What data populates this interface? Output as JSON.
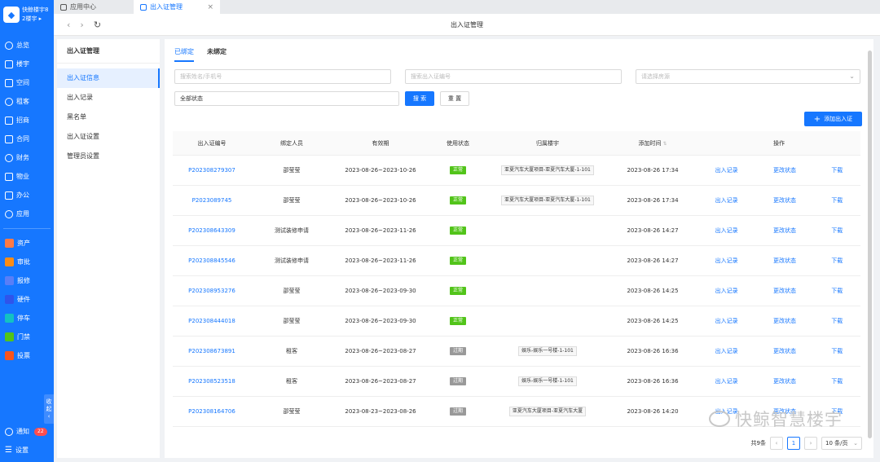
{
  "brand": {
    "name": "快鲸楼宇8",
    "sub": "2楼宇 ▸"
  },
  "sidebar": {
    "items": [
      {
        "label": "总览",
        "icon": "overview-icon"
      },
      {
        "label": "楼宇",
        "icon": "building-icon"
      },
      {
        "label": "空间",
        "icon": "space-icon"
      },
      {
        "label": "租客",
        "icon": "tenant-icon"
      },
      {
        "label": "招商",
        "icon": "investment-icon"
      },
      {
        "label": "合同",
        "icon": "contract-icon"
      },
      {
        "label": "财务",
        "icon": "finance-icon"
      },
      {
        "label": "物业",
        "icon": "property-icon"
      },
      {
        "label": "办公",
        "icon": "office-icon"
      },
      {
        "label": "应用",
        "icon": "apps-icon"
      }
    ],
    "apps": [
      {
        "label": "资产",
        "color": "#ff7a45"
      },
      {
        "label": "审批",
        "color": "#fa8c16"
      },
      {
        "label": "报修",
        "color": "#597ef7"
      },
      {
        "label": "硬件",
        "color": "#2f54eb"
      },
      {
        "label": "停车",
        "color": "#13c2c2"
      },
      {
        "label": "门禁",
        "color": "#52c41a"
      },
      {
        "label": "投票",
        "color": "#fa541c"
      }
    ],
    "collapse": {
      "line1": "收",
      "line2": "起"
    },
    "notify": {
      "label": "通知",
      "count": "22"
    },
    "settings": {
      "label": "设置"
    }
  },
  "tabs": [
    {
      "label": "应用中心"
    },
    {
      "label": "出入证管理"
    }
  ],
  "page_title": "出入证管理",
  "submenu": {
    "title": "出入证管理",
    "items": [
      "出入证信息",
      "出入记录",
      "黑名单",
      "出入证设置",
      "管理员设置"
    ]
  },
  "subtabs": [
    "已绑定",
    "未绑定"
  ],
  "filters": {
    "name_placeholder": "搜索姓名/手机号",
    "code_placeholder": "搜索出入证编号",
    "room_placeholder": "请选择房源",
    "status_value": "全部状态",
    "search_label": "搜 索",
    "reset_label": "重 置"
  },
  "add_button": "添加出入证",
  "table": {
    "headers": [
      "出入证编号",
      "绑定人员",
      "有效期",
      "使用状态",
      "归属楼宇",
      "添加时间",
      "操作"
    ],
    "rows": [
      {
        "code": "P202308279307",
        "person": "邵莹莹",
        "period": "2023-08-26~2023-10-26",
        "status": "正常",
        "building": "亚夏汽车大厦项目-亚夏汽车大厦-1-101",
        "time": "2023-08-26 17:34"
      },
      {
        "code": "P2023089745",
        "person": "邵莹莹",
        "period": "2023-08-26~2023-10-26",
        "status": "正常",
        "building": "亚夏汽车大厦项目-亚夏汽车大厦-1-101",
        "time": "2023-08-26 17:34"
      },
      {
        "code": "P202308643309",
        "person": "测试装修申请",
        "period": "2023-08-26~2023-11-26",
        "status": "正常",
        "building": "",
        "time": "2023-08-26 14:27"
      },
      {
        "code": "P202308845546",
        "person": "测试装修申请",
        "period": "2023-08-26~2023-11-26",
        "status": "正常",
        "building": "",
        "time": "2023-08-26 14:27"
      },
      {
        "code": "P202308953276",
        "person": "邵莹莹",
        "period": "2023-08-26~2023-09-30",
        "status": "正常",
        "building": "",
        "time": "2023-08-26 14:25"
      },
      {
        "code": "P202308444018",
        "person": "邵莹莹",
        "period": "2023-08-26~2023-09-30",
        "status": "正常",
        "building": "",
        "time": "2023-08-26 14:25"
      },
      {
        "code": "P202308673891",
        "person": "租客",
        "period": "2023-08-26~2023-08-27",
        "status": "过期",
        "building": "娱乐-娱乐一号楼-1-101",
        "time": "2023-08-26 16:36"
      },
      {
        "code": "P202308523518",
        "person": "租客",
        "period": "2023-08-26~2023-08-27",
        "status": "过期",
        "building": "娱乐-娱乐一号楼-1-101",
        "time": "2023-08-26 16:36"
      },
      {
        "code": "P202308164706",
        "person": "邵莹莹",
        "period": "2023-08-23~2023-08-26",
        "status": "过期",
        "building": "亚夏汽车大厦项目-亚夏汽车大厦",
        "time": "2023-08-26 14:20"
      }
    ],
    "ops": [
      "出入记录",
      "更改状态",
      "下载"
    ]
  },
  "pager": {
    "total": "共9条",
    "current": "1",
    "size": "10 条/页"
  },
  "watermark": "快鲸智慧楼宇"
}
